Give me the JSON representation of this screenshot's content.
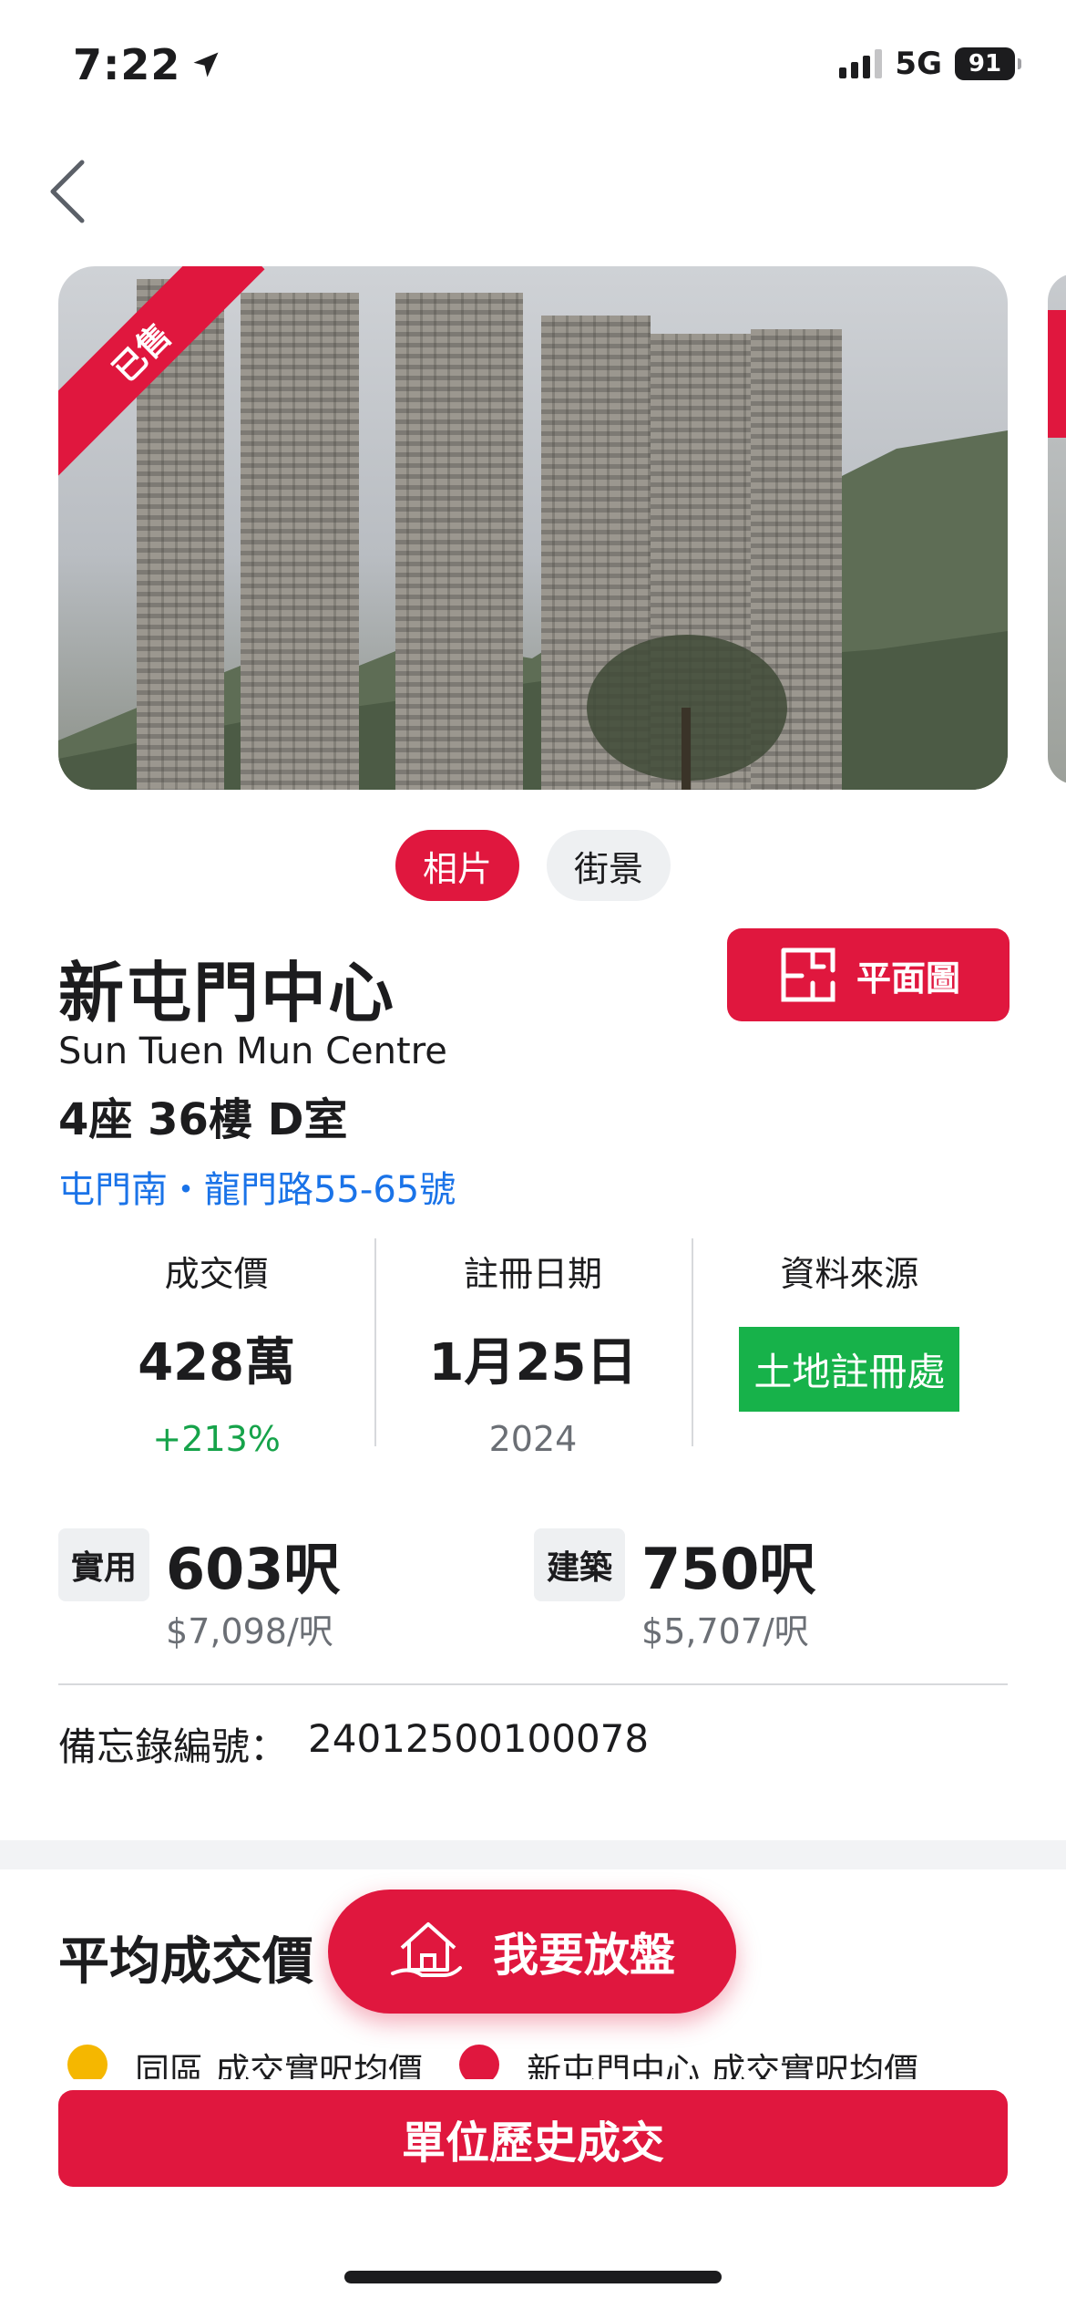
{
  "status_bar": {
    "time": "7:22",
    "network": "5G",
    "battery": "91",
    "icons": [
      "location-arrow-icon",
      "signal-icon",
      "battery-icon"
    ]
  },
  "nav": {
    "back_icon": "chevron-left-icon"
  },
  "photo": {
    "sold_label": "已售"
  },
  "media_tabs": [
    {
      "label": "相片",
      "active": true
    },
    {
      "label": "街景",
      "active": false
    }
  ],
  "property": {
    "name_zh": "新屯門中心",
    "name_en": "Sun Tuen Mun Centre",
    "unit": "4座 36樓 D室",
    "address": "屯門南・龍門路55-65號",
    "floorplan_label": "平面圖"
  },
  "stats": {
    "price_label": "成交價",
    "price_value": "428萬",
    "price_change": "+213%",
    "date_label": "註冊日期",
    "date_value": "1月25日",
    "date_year": "2024",
    "source_label": "資料來源",
    "source_value": "土地註冊處"
  },
  "area": {
    "saleable_tag": "實用",
    "saleable_value": "603呎",
    "saleable_price": "$7,098/呎",
    "gross_tag": "建築",
    "gross_value": "750呎",
    "gross_price": "$5,707/呎"
  },
  "memo": {
    "label": "備忘錄編號：",
    "value": "24012500100078"
  },
  "avg_section": {
    "title": "平均成交價",
    "legend": [
      {
        "label": "同區 成交實呎均價",
        "color": "#f5b700"
      },
      {
        "label": "新屯門中心 成交實呎均價",
        "color": "#e0173e"
      }
    ]
  },
  "actions": {
    "list_property": "我要放盤",
    "unit_history": "單位歷史成交"
  },
  "colors": {
    "accent": "#e0173e",
    "link": "#1a73e8",
    "positive": "#16a34a",
    "source_badge": "#17b24a"
  }
}
